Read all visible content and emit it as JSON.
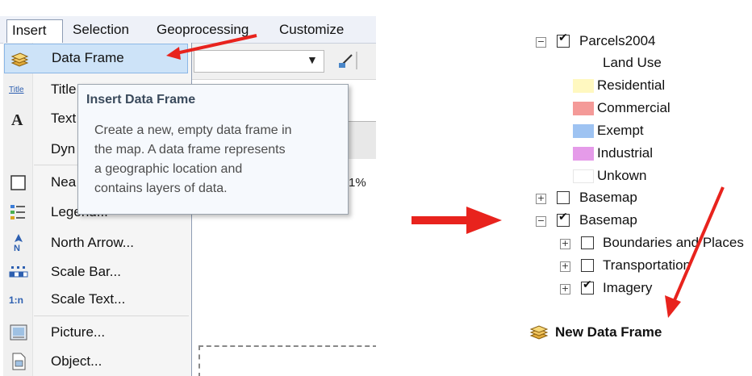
{
  "menubar": {
    "items": [
      "Insert",
      "Selection",
      "Geoprocessing",
      "Customize"
    ]
  },
  "dropdown": {
    "items": [
      {
        "label": "Data Frame",
        "icon": "data-frame-icon"
      },
      {
        "label": "Title",
        "icon": "title-icon"
      },
      {
        "label": "Text",
        "icon": "text-icon"
      },
      {
        "label": "Dyn",
        "icon": ""
      },
      {
        "label": "Nea",
        "icon": "neatline-icon"
      },
      {
        "label": "Legend...",
        "icon": "legend-icon"
      },
      {
        "label": "North Arrow...",
        "icon": "north-arrow-icon"
      },
      {
        "label": "Scale Bar...",
        "icon": "scale-bar-icon"
      },
      {
        "label": "Scale Text...",
        "icon": "scale-text-icon"
      },
      {
        "label": "Picture...",
        "icon": "picture-icon"
      },
      {
        "label": "Object...",
        "icon": "object-icon"
      }
    ]
  },
  "tooltip": {
    "title": "Insert Data Frame",
    "lines": [
      "Create a new, empty data frame in",
      "the map. A data frame represents",
      "a geographic location and",
      "contains layers of data."
    ]
  },
  "background_app": {
    "percent": "1%"
  },
  "toc": {
    "layer_parcels": {
      "label": "Parcels2004",
      "expanded": true,
      "checked": true
    },
    "legend_heading": "Land Use",
    "legend": [
      {
        "label": "Residential",
        "color": "#fff8c0"
      },
      {
        "label": "Commercial",
        "color": "#f49a98"
      },
      {
        "label": "Exempt",
        "color": "#9ec3f2"
      },
      {
        "label": "Industrial",
        "color": "#e59be9"
      },
      {
        "label": "Unkown",
        "color": "#ffffff"
      }
    ],
    "basemap_collapsed": {
      "label": "Basemap",
      "expanded": false,
      "checked": false
    },
    "basemap_expanded": {
      "label": "Basemap",
      "expanded": true,
      "checked": true
    },
    "sublayers": [
      {
        "label": "Boundaries and Places",
        "checked": false
      },
      {
        "label": "Transportation",
        "checked": false
      },
      {
        "label": "Imagery",
        "checked": true
      }
    ],
    "new_data_frame": "New Data Frame"
  },
  "colors": {
    "arrow_red": "#e8231d",
    "highlight": "#cde3f8"
  }
}
